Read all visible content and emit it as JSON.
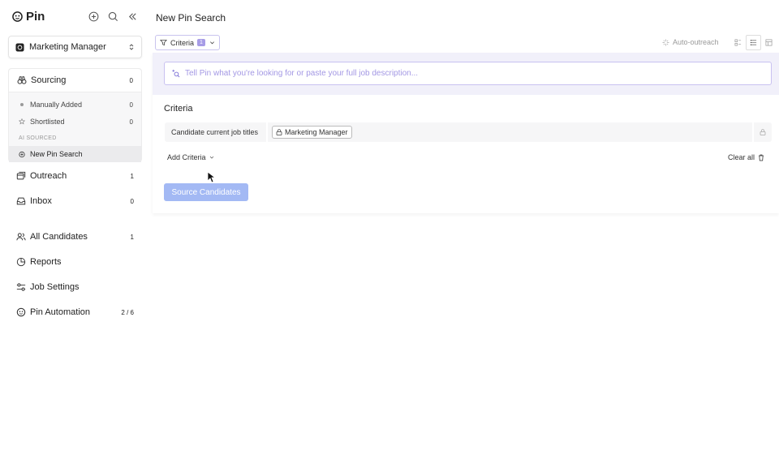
{
  "app": {
    "name": "Pin"
  },
  "sidebar": {
    "job_select": {
      "label": "Marketing Manager"
    },
    "sourcing": {
      "label": "Sourcing",
      "count": "0",
      "items": [
        {
          "label": "Manually Added",
          "count": "0"
        },
        {
          "label": "Shortlisted",
          "count": "0"
        }
      ],
      "section_label": "AI SOURCED",
      "ai_items": [
        {
          "label": "New Pin Search"
        }
      ]
    },
    "nav": [
      {
        "label": "Outreach",
        "count": "1",
        "icon": "outreach-icon"
      },
      {
        "label": "Inbox",
        "count": "0",
        "icon": "inbox-icon"
      },
      {
        "label": "All Candidates",
        "count": "1",
        "icon": "users-icon"
      },
      {
        "label": "Reports",
        "count": "",
        "icon": "pie-chart-icon"
      },
      {
        "label": "Job Settings",
        "count": "",
        "icon": "sliders-icon"
      },
      {
        "label": "Pin Automation",
        "count": "2 / 6",
        "icon": "pin-automation-icon"
      }
    ]
  },
  "main": {
    "title": "New Pin Search",
    "criteria_button": {
      "label": "Criteria",
      "badge": "1"
    },
    "auto_outreach": {
      "label": "Auto-outreach"
    },
    "prompt": {
      "placeholder": "Tell Pin what you're looking for or paste your full job description..."
    },
    "criteria": {
      "title": "Criteria",
      "rows": [
        {
          "field": "Candidate current job titles",
          "values": [
            "Marketing Manager"
          ]
        }
      ],
      "add_label": "Add Criteria",
      "clear_label": "Clear all"
    },
    "source_button": {
      "label": "Source Candidates"
    }
  },
  "colors": {
    "accent": "#a79ce6",
    "prompt_text": "#a398e4",
    "panel_bg": "#f1f0fa",
    "source_button": "#a3b9f4"
  }
}
